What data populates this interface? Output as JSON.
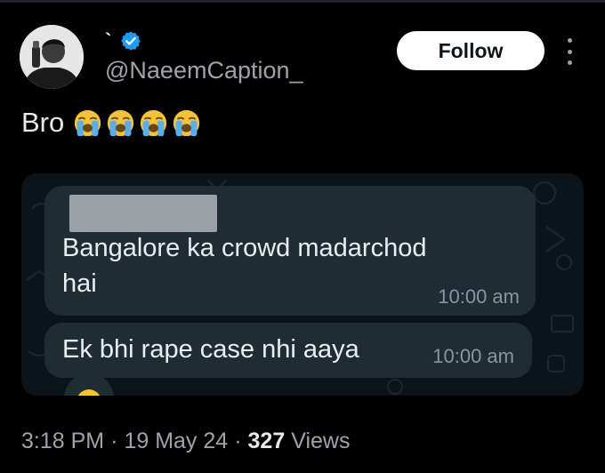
{
  "author": {
    "display_name": "`",
    "handle": "@NaeemCaption_",
    "verified": true
  },
  "follow_label": "Follow",
  "tweet": {
    "text": "Bro",
    "emojis": [
      "loudly-crying-face",
      "loudly-crying-face",
      "loudly-crying-face",
      "loudly-crying-face"
    ]
  },
  "chat": {
    "messages": [
      {
        "sender_redacted": true,
        "text": "Bangalore ka crowd madarchod hai",
        "time": "10:00 am"
      },
      {
        "text": "Ek bhi rape case nhi aaya",
        "time": "10:00 am"
      }
    ]
  },
  "meta": {
    "time": "3:18 PM",
    "sep1": "·",
    "date": "19 May 24",
    "sep2": "·",
    "views_count": "327",
    "views_label": "Views"
  },
  "colors": {
    "background": "#000000",
    "verified_blue": "#1d9bf0",
    "chat_bg": "#0b141a",
    "bubble": "#1f2c34"
  }
}
